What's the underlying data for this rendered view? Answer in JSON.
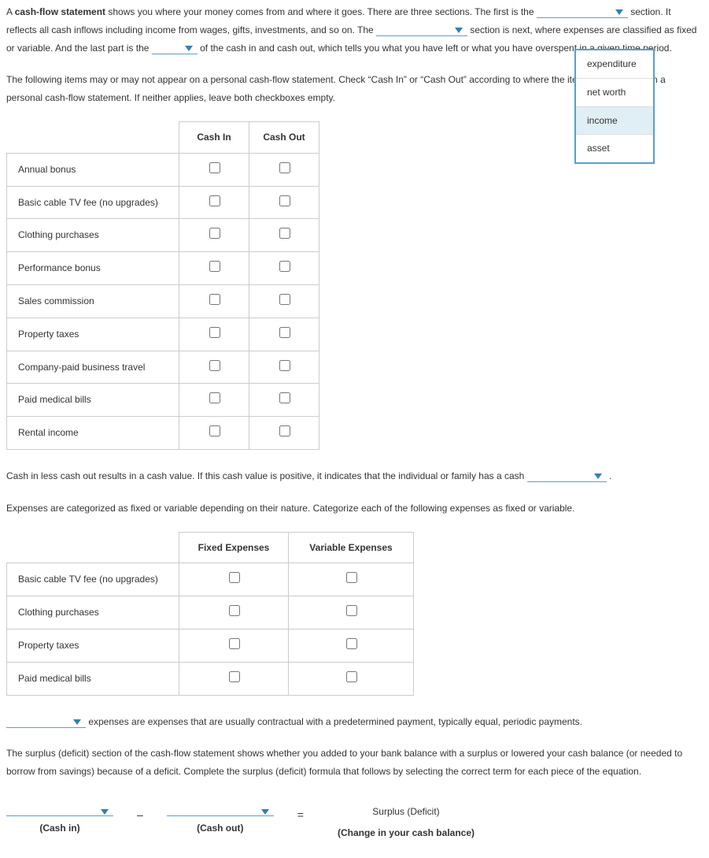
{
  "para1": {
    "t1": "A ",
    "bold1": "cash-flow statement",
    "t2": " shows you where your money comes from and where it goes. There are three sections. The first is the ",
    "t3": " section. It reflects all cash inflows including income from wages, gifts, investments, and so on. The ",
    "t4": " section is next, where expenses are classified as fixed or variable. And the last part is the ",
    "t5": " of the cash in and cash out, which tells you what you have left or what you have overspent in a given time period."
  },
  "para2": "The following items may or may not appear on a personal cash-flow statement. Check “Cash In” or “Cash Out” according to where the item would appear on a personal cash-flow statement. If neither applies, leave both checkboxes empty.",
  "table1": {
    "headers": [
      "Cash In",
      "Cash Out"
    ],
    "rows": [
      "Annual bonus",
      "Basic cable TV fee (no upgrades)",
      "Clothing purchases",
      "Performance bonus",
      "Sales commission",
      "Property taxes",
      "Company-paid business travel",
      "Paid medical bills",
      "Rental income"
    ]
  },
  "para3": {
    "t1": "Cash in less cash out results in a cash value. If this cash value is positive, it indicates that the individual or family has a cash ",
    "t2": " ."
  },
  "para4": "Expenses are categorized as fixed or variable depending on their nature. Categorize each of the following expenses as fixed or variable.",
  "table2": {
    "headers": [
      "Fixed Expenses",
      "Variable Expenses"
    ],
    "rows": [
      "Basic cable TV fee (no upgrades)",
      "Clothing purchases",
      "Property taxes",
      "Paid medical bills"
    ]
  },
  "para5": " expenses are expenses that are usually contractual with a predetermined payment, typically equal, periodic payments.",
  "para6": "The surplus (deficit) section of the cash-flow statement shows whether you added to your bank balance with a surplus or lowered your cash balance (or needed to borrow from savings) because of a deficit. Complete the surplus (deficit) formula that follows by selecting the correct term for each piece of the equation.",
  "formula": {
    "minus": "–",
    "equals": "=",
    "result_top": "Surplus (Deficit)",
    "cashin": "(Cash in)",
    "cashout": "(Cash out)",
    "change": "(Change in your cash balance)"
  },
  "dropdown": {
    "options": [
      "expenditure",
      "net worth",
      "income",
      "asset"
    ],
    "selected_index": 2
  }
}
